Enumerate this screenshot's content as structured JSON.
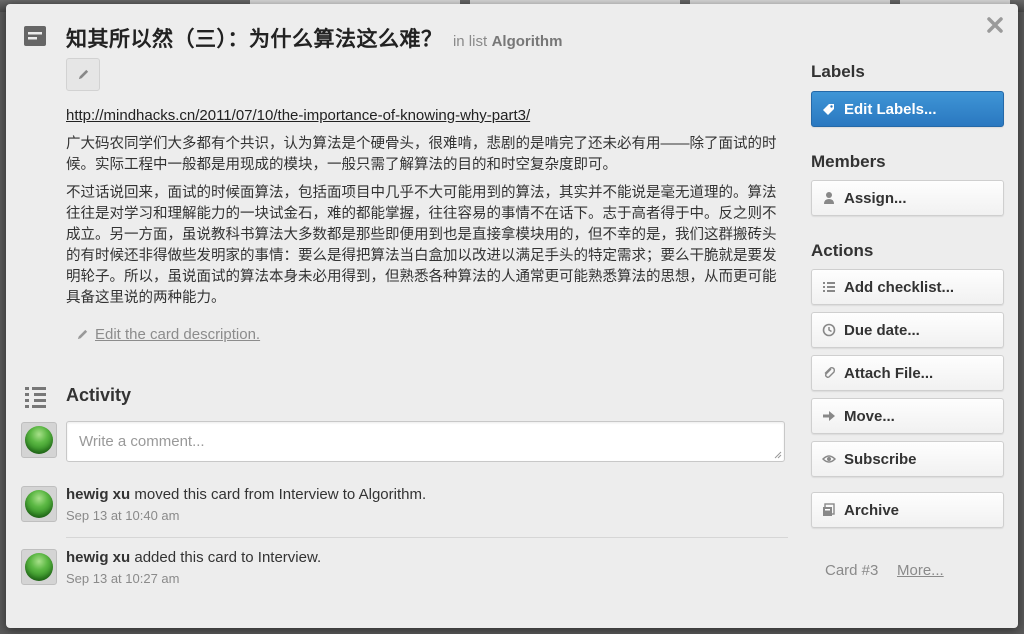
{
  "card": {
    "title": "知其所以然（三）：为什么算法这么难？",
    "in_list_prefix": "in list",
    "list_name": "Algorithm",
    "description": {
      "link": "http://mindhacks.cn/2011/07/10/the-importance-of-knowing-why-part3/",
      "paragraphs": [
        "广大码农同学们大多都有个共识，认为算法是个硬骨头，很难啃，悲剧的是啃完了还未必有用——除了面试的时候。实际工程中一般都是用现成的模块，一般只需了解算法的目的和时空复杂度即可。",
        "不过话说回来，面试的时候面算法，包括面项目中几乎不大可能用到的算法，其实并不能说是毫无道理的。算法往往是对学习和理解能力的一块试金石，难的都能掌握，往往容易的事情不在话下。志于高者得于中。反之则不成立。另一方面，虽说教科书算法大多数都是那些即便用到也是直接拿模块用的，但不幸的是，我们这群搬砖头的有时候还非得做些发明家的事情：要么是得把算法当白盒加以改进以满足手头的特定需求；要么干脆就是要发明轮子。所以，虽说面试的算法本身未必用得到，但熟悉各种算法的人通常更可能熟悉算法的思想，从而更可能具备这里说的两种能力。"
      ],
      "edit_label": "Edit the card description."
    }
  },
  "activity": {
    "title": "Activity",
    "comment_placeholder": "Write a comment...",
    "items": [
      {
        "user": "hewig xu",
        "action": "moved this card from Interview to Algorithm.",
        "time": "Sep 13 at 10:40 am"
      },
      {
        "user": "hewig xu",
        "action": "added this card to Interview.",
        "time": "Sep 13 at 10:27 am"
      }
    ]
  },
  "sidebar": {
    "labels_heading": "Labels",
    "edit_labels": "Edit Labels...",
    "members_heading": "Members",
    "assign": "Assign...",
    "actions_heading": "Actions",
    "actions": {
      "add_checklist": "Add checklist...",
      "due_date": "Due date...",
      "attach_file": "Attach File...",
      "move": "Move...",
      "subscribe": "Subscribe",
      "archive": "Archive"
    },
    "card_number": "Card #3",
    "more": "More..."
  },
  "colors": {
    "primary_button": "#2a78c0",
    "window_bg": "#ededed",
    "avatar_green": "#3c9a2c"
  },
  "icons": [
    "card-icon",
    "pencil-icon",
    "activity-list-icon",
    "tag-icon",
    "person-icon",
    "checklist-icon",
    "clock-icon",
    "paperclip-icon",
    "arrow-right-icon",
    "eye-icon",
    "archive-icon",
    "close-icon"
  ]
}
